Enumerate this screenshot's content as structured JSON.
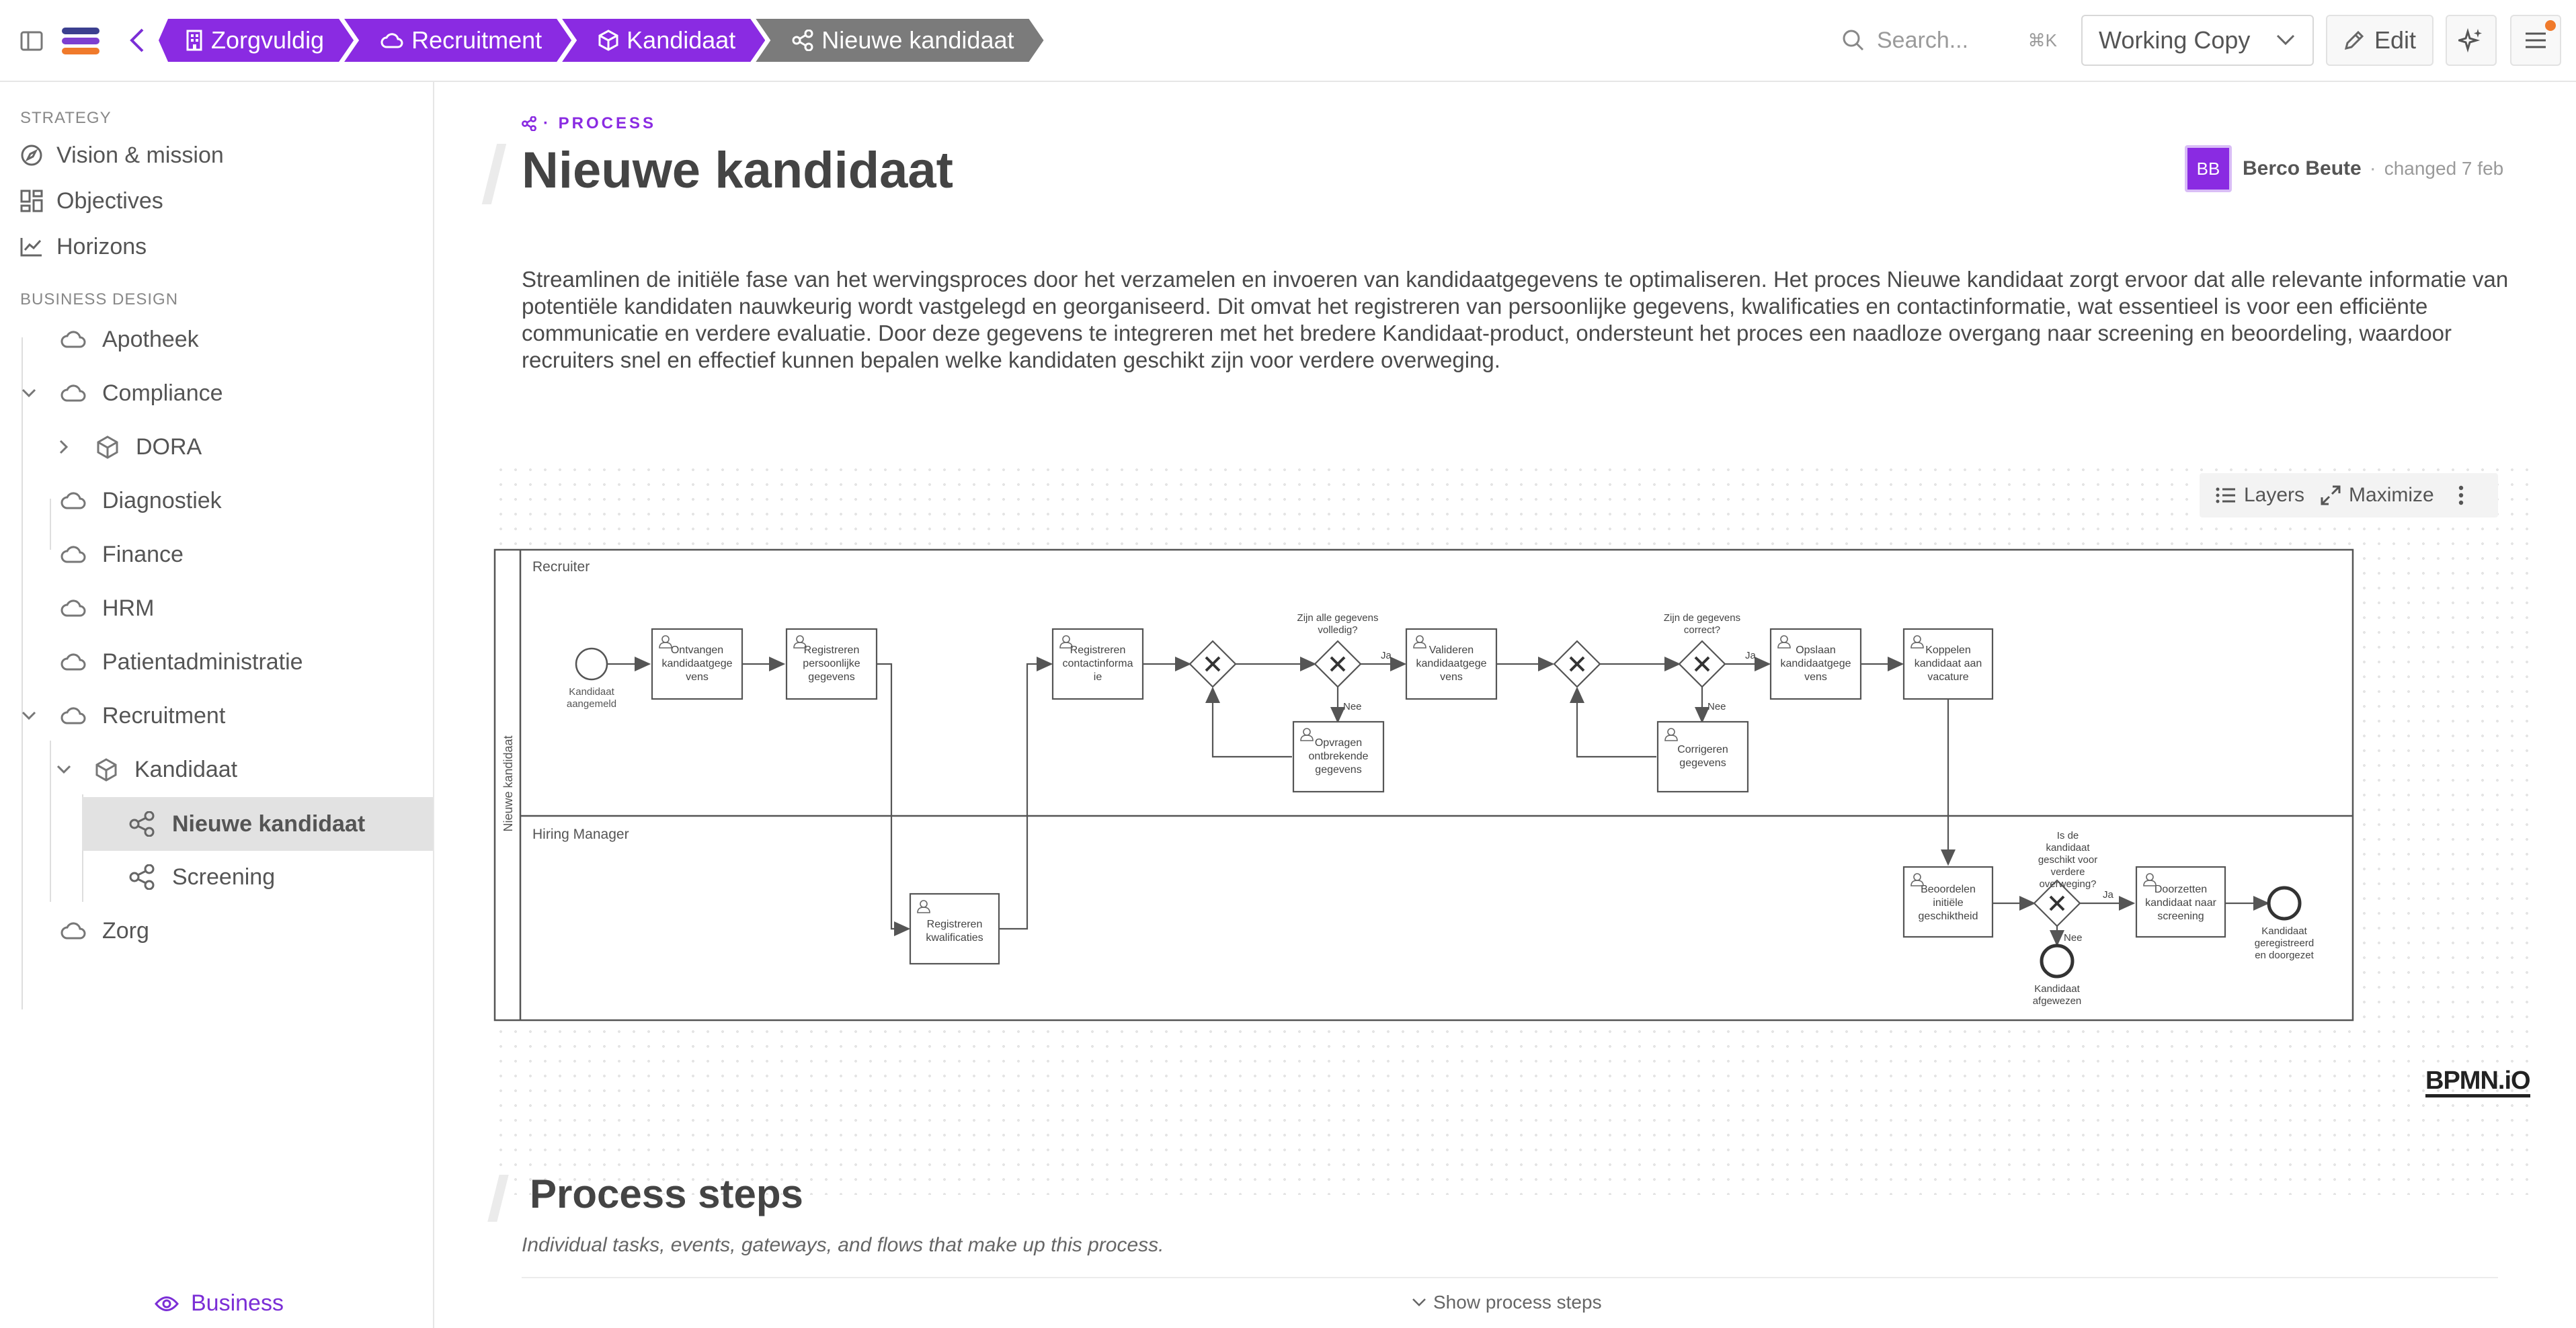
{
  "breadcrumbs": [
    {
      "label": "Zorgvuldig",
      "icon": "building-icon"
    },
    {
      "label": "Recruitment",
      "icon": "cloud-icon"
    },
    {
      "label": "Kandidaat",
      "icon": "cube-icon"
    },
    {
      "label": "Nieuwe kandidaat",
      "icon": "share-nodes-icon"
    }
  ],
  "search": {
    "placeholder": "Search...",
    "shortcut": "⌘K"
  },
  "version_select": {
    "value": "Working Copy"
  },
  "edit_label": "Edit",
  "sidebar": {
    "strategy_label": "STRATEGY",
    "strategy_items": [
      "Vision & mission",
      "Objectives",
      "Horizons"
    ],
    "business_label": "BUSINESS DESIGN",
    "tree": [
      "Apotheek",
      "Compliance",
      "DORA",
      "Diagnostiek",
      "Finance",
      "HRM",
      "Patientadministratie",
      "Recruitment",
      "Kandidaat",
      "Nieuwe kandidaat",
      "Screening",
      "Zorg"
    ],
    "footer_label": "Business"
  },
  "page": {
    "kicker": "· PROCESS",
    "title": "Nieuwe kandidaat",
    "author_initials": "BB",
    "author_name": "Berco Beute",
    "separator": "·",
    "changed": "changed 7 feb",
    "description": "Streamlinen de initiële fase van het wervingsproces door het verzamelen en invoeren van kandidaatgegevens te optimaliseren. Het proces Nieuwe kandidaat zorgt ervoor dat alle relevante informatie van potentiële kandidaten nauwkeurig wordt vastgelegd en georganiseerd. Dit omvat het registreren van persoonlijke gegevens, kwalificaties en contactinformatie, wat essentieel is voor een efficiënte communicatie en verdere evaluatie. Door deze gegevens te integreren met het bredere Kandidaat-product, ondersteunt het proces een naadloze overgang naar screening en beoordeling, waardoor recruiters snel en effectief kunnen bepalen welke kandidaten geschikt zijn voor verdere overweging."
  },
  "canvas_tools": {
    "layers": "Layers",
    "maximize": "Maximize"
  },
  "bpmn": {
    "pool": "Nieuwe kandidaat",
    "lanes": [
      "Recruiter",
      "Hiring Manager"
    ],
    "start_event": [
      "Kandidaat",
      "aangemeld"
    ],
    "tasks": {
      "ontvangen": [
        "Ontvangen",
        "kandidaatgege",
        "vens"
      ],
      "persoonlijk": [
        "Registreren",
        "persoonlijke",
        "gegevens"
      ],
      "kwalificaties": [
        "Registreren",
        "kwalificaties"
      ],
      "contact": [
        "Registreren",
        "contactinforma",
        "ie"
      ],
      "valideren": [
        "Valideren",
        "kandidaatgege",
        "vens"
      ],
      "opvragen": [
        "Opvragen",
        "ontbrekende",
        "gegevens"
      ],
      "opslaan": [
        "Opslaan",
        "kandidaatgege",
        "vens"
      ],
      "corrigeren": [
        "Corrigeren",
        "gegevens"
      ],
      "koppelen": [
        "Koppelen",
        "kandidaat aan",
        "vacature"
      ],
      "beoordelen": [
        "Beoordelen",
        "initiële",
        "geschiktheid"
      ],
      "doorzetten": [
        "Doorzetten",
        "kandidaat naar",
        "screening"
      ]
    },
    "gateways": {
      "volledig": [
        "Zijn alle gegevens",
        "volledig?"
      ],
      "correct": [
        "Zijn de gegevens",
        "correct?"
      ],
      "geschikt": [
        "Is de",
        "kandidaat",
        "geschikt voor",
        "verdere",
        "overweging?"
      ]
    },
    "flow_labels": {
      "ja": "Ja",
      "nee": "Nee"
    },
    "end_events": {
      "doorgezet": [
        "Kandidaat",
        "geregistreerd",
        "en doorgezet"
      ],
      "afgewezen": [
        "Kandidaat",
        "afgewezen"
      ]
    }
  },
  "bpmn_logo": "BPMN.iO",
  "steps": {
    "title": "Process steps",
    "subtitle": "Individual tasks, events, gateways, and flows that make up this process.",
    "toggle": "Show process steps"
  },
  "colors": {
    "accent": "#8a2be2",
    "crumb_current": "#7b7b7b",
    "active_item": "#e2e2e2"
  }
}
